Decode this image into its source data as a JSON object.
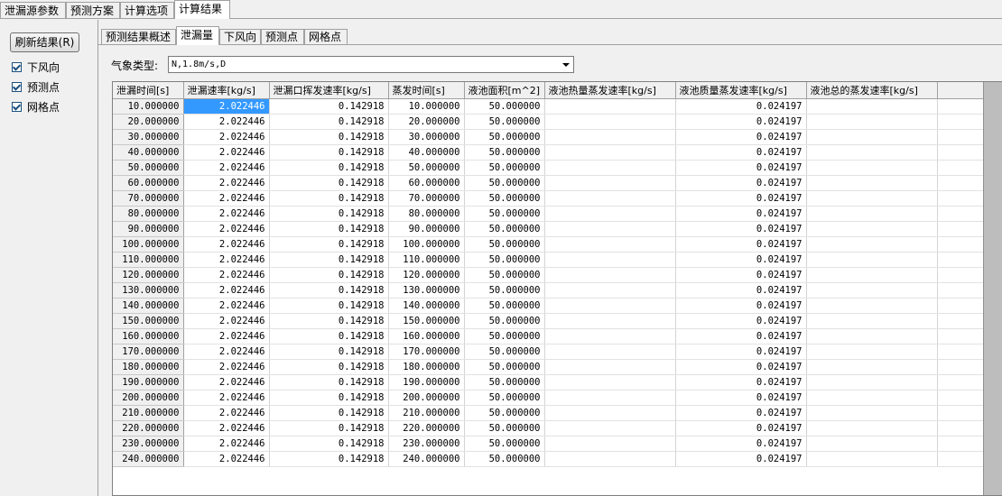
{
  "top_tabs": [
    "泄漏源参数",
    "预测方案",
    "计算选项",
    "计算结果"
  ],
  "refresh_label": "刷新结果(R)",
  "checkboxes": [
    {
      "label": "下风向",
      "checked": true
    },
    {
      "label": "预测点",
      "checked": true
    },
    {
      "label": "网格点",
      "checked": true
    }
  ],
  "inner_tabs": [
    "预测结果概述",
    "泄漏量",
    "下风向",
    "预测点",
    "网格点"
  ],
  "weather": {
    "label": "气象类型:",
    "value": "N,1.8m/s,D"
  },
  "table": {
    "columns": [
      "泄漏时间[s]",
      "泄漏速率[kg/s]",
      "泄漏口挥发速率[kg/s]",
      "蒸发时间[s]",
      "液池面积[m^2]",
      "液池热量蒸发速率[kg/s]",
      "液池质量蒸发速率[kg/s]",
      "液池总的蒸发速率[kg/s]"
    ],
    "rows": [
      [
        "10.000000",
        "2.022446",
        "0.142918",
        "10.000000",
        "50.000000",
        "",
        "0.024197",
        ""
      ],
      [
        "20.000000",
        "2.022446",
        "0.142918",
        "20.000000",
        "50.000000",
        "",
        "0.024197",
        ""
      ],
      [
        "30.000000",
        "2.022446",
        "0.142918",
        "30.000000",
        "50.000000",
        "",
        "0.024197",
        ""
      ],
      [
        "40.000000",
        "2.022446",
        "0.142918",
        "40.000000",
        "50.000000",
        "",
        "0.024197",
        ""
      ],
      [
        "50.000000",
        "2.022446",
        "0.142918",
        "50.000000",
        "50.000000",
        "",
        "0.024197",
        ""
      ],
      [
        "60.000000",
        "2.022446",
        "0.142918",
        "60.000000",
        "50.000000",
        "",
        "0.024197",
        ""
      ],
      [
        "70.000000",
        "2.022446",
        "0.142918",
        "70.000000",
        "50.000000",
        "",
        "0.024197",
        ""
      ],
      [
        "80.000000",
        "2.022446",
        "0.142918",
        "80.000000",
        "50.000000",
        "",
        "0.024197",
        ""
      ],
      [
        "90.000000",
        "2.022446",
        "0.142918",
        "90.000000",
        "50.000000",
        "",
        "0.024197",
        ""
      ],
      [
        "100.000000",
        "2.022446",
        "0.142918",
        "100.000000",
        "50.000000",
        "",
        "0.024197",
        ""
      ],
      [
        "110.000000",
        "2.022446",
        "0.142918",
        "110.000000",
        "50.000000",
        "",
        "0.024197",
        ""
      ],
      [
        "120.000000",
        "2.022446",
        "0.142918",
        "120.000000",
        "50.000000",
        "",
        "0.024197",
        ""
      ],
      [
        "130.000000",
        "2.022446",
        "0.142918",
        "130.000000",
        "50.000000",
        "",
        "0.024197",
        ""
      ],
      [
        "140.000000",
        "2.022446",
        "0.142918",
        "140.000000",
        "50.000000",
        "",
        "0.024197",
        ""
      ],
      [
        "150.000000",
        "2.022446",
        "0.142918",
        "150.000000",
        "50.000000",
        "",
        "0.024197",
        ""
      ],
      [
        "160.000000",
        "2.022446",
        "0.142918",
        "160.000000",
        "50.000000",
        "",
        "0.024197",
        ""
      ],
      [
        "170.000000",
        "2.022446",
        "0.142918",
        "170.000000",
        "50.000000",
        "",
        "0.024197",
        ""
      ],
      [
        "180.000000",
        "2.022446",
        "0.142918",
        "180.000000",
        "50.000000",
        "",
        "0.024197",
        ""
      ],
      [
        "190.000000",
        "2.022446",
        "0.142918",
        "190.000000",
        "50.000000",
        "",
        "0.024197",
        ""
      ],
      [
        "200.000000",
        "2.022446",
        "0.142918",
        "200.000000",
        "50.000000",
        "",
        "0.024197",
        ""
      ],
      [
        "210.000000",
        "2.022446",
        "0.142918",
        "210.000000",
        "50.000000",
        "",
        "0.024197",
        ""
      ],
      [
        "220.000000",
        "2.022446",
        "0.142918",
        "220.000000",
        "50.000000",
        "",
        "0.024197",
        ""
      ],
      [
        "230.000000",
        "2.022446",
        "0.142918",
        "230.000000",
        "50.000000",
        "",
        "0.024197",
        ""
      ],
      [
        "240.000000",
        "2.022446",
        "0.142918",
        "240.000000",
        "50.000000",
        "",
        "0.024197",
        ""
      ]
    ]
  }
}
